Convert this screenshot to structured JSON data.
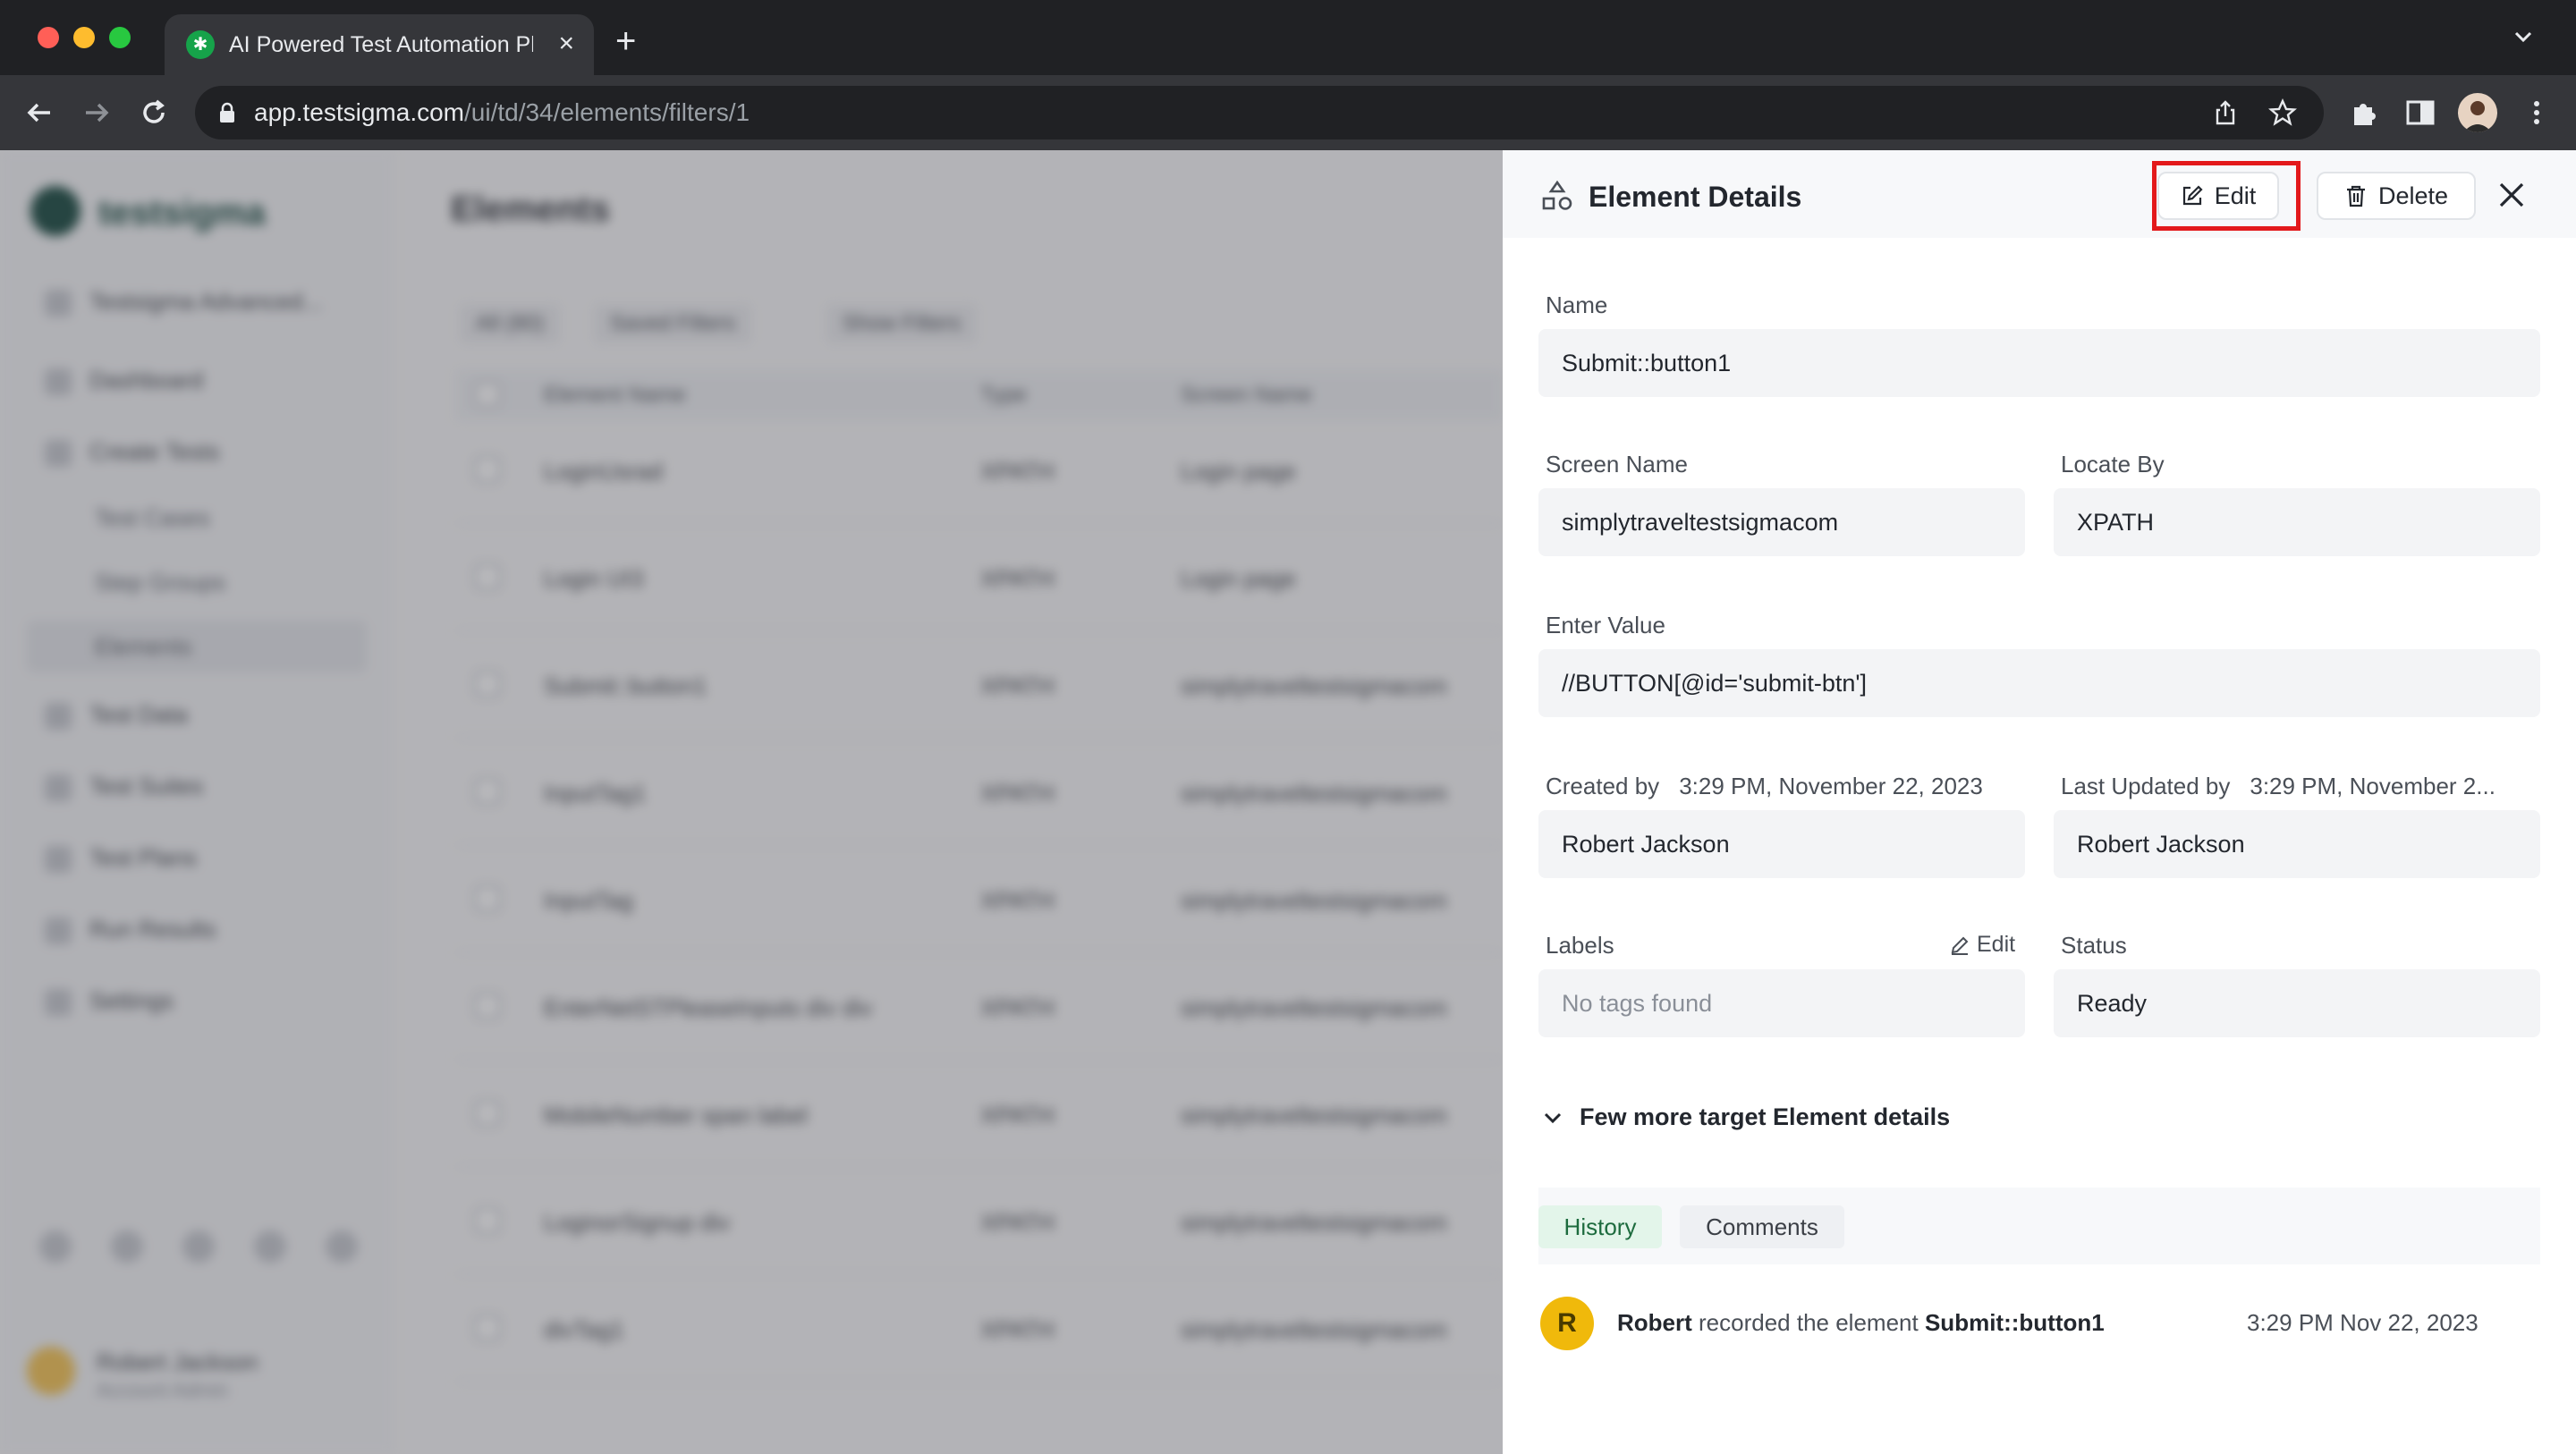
{
  "browser": {
    "tab_title": "AI Powered Test Automation Platform",
    "url_host": "app.testsigma.com",
    "url_path": "/ui/td/34/elements/filters/1"
  },
  "app": {
    "logo_text": "testsigma",
    "page_title": "Elements",
    "sidebar": {
      "workspace": "Testsigma Advanced...",
      "items": [
        "Dashboard",
        "Create Tests",
        "Test Data",
        "Test Suites",
        "Test Plans",
        "Run Results",
        "Settings"
      ],
      "sub_items": [
        "Test Cases",
        "Step Groups",
        "Elements"
      ],
      "user_name": "Robert Jackson",
      "user_role": "Account Admin"
    },
    "filters": [
      "All (80)",
      "Saved Filters",
      "Show Filters"
    ],
    "table": {
      "columns": [
        "Element Name",
        "Type",
        "Screen Name"
      ],
      "rows": [
        {
          "name": "LoginUsrad",
          "type": "XPATH",
          "screen": "Login page"
        },
        {
          "name": "Login UI3",
          "type": "XPATH",
          "screen": "Login page"
        },
        {
          "name": "Submit::button1",
          "type": "XPATH",
          "screen": "simplytraveltestsigmacom"
        },
        {
          "name": "InputTag1",
          "type": "XPATH",
          "screen": "simplytraveltestsigmacom"
        },
        {
          "name": "InputTag",
          "type": "XPATH",
          "screen": "simplytraveltestsigmacom"
        },
        {
          "name": "EnterNetSTPleaseInputs div div",
          "type": "XPATH",
          "screen": "simplytraveltestsigmacom"
        },
        {
          "name": "MobileNumber span label",
          "type": "XPATH",
          "screen": "simplytraveltestsigmacom"
        },
        {
          "name": "LoginorSignup div",
          "type": "XPATH",
          "screen": "simplytraveltestsigmacom"
        },
        {
          "name": "divTag1",
          "type": "XPATH",
          "screen": "simplytraveltestsigmacom"
        }
      ]
    }
  },
  "panel": {
    "title": "Element Details",
    "edit_label": "Edit",
    "delete_label": "Delete",
    "name_label": "Name",
    "name_value": "Submit::button1",
    "screen_label": "Screen Name",
    "screen_value": "simplytraveltestsigmacom",
    "locate_label": "Locate By",
    "locate_value": "XPATH",
    "enter_value_label": "Enter Value",
    "enter_value": "//BUTTON[@id='submit-btn']",
    "created_label": "Created by",
    "created_time": "3:29 PM, November 22, 2023",
    "created_by": "Robert Jackson",
    "updated_label": "Last Updated by",
    "updated_time": "3:29 PM, November 2...",
    "updated_by": "Robert Jackson",
    "labels_label": "Labels",
    "labels_edit": "Edit",
    "labels_value": "No tags found",
    "status_label": "Status",
    "status_value": "Ready",
    "more_details": "Few more target Element details",
    "tabs": [
      "History",
      "Comments"
    ],
    "history": {
      "avatar_letter": "R",
      "user": "Robert",
      "action": "recorded the element",
      "element": "Submit::button1",
      "time": "3:29 PM Nov 22, 2023"
    }
  },
  "colors": {
    "highlight": "#e3191b",
    "history_tab_bg": "#e3f5ea",
    "history_tab_text": "#1d6b3e",
    "avatar": "#f0b90b"
  }
}
